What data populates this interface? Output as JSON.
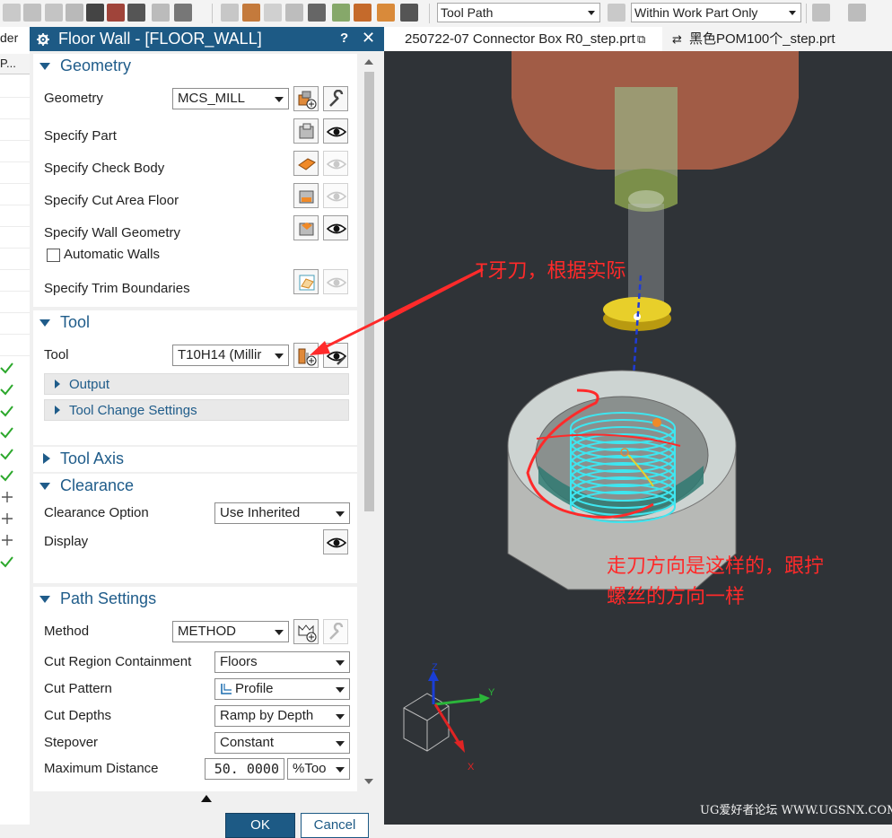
{
  "toolbar": {
    "filter_combo": "Tool Path",
    "scope_combo": "Within Work Part Only"
  },
  "left_strip": {
    "header": "der",
    "col": "P..."
  },
  "dialog": {
    "title": "Floor Wall - [FLOOR_WALL]",
    "help": "?",
    "close": "✕",
    "ok": "OK",
    "cancel": "Cancel"
  },
  "geometry": {
    "heading": "Geometry",
    "geometry_label": "Geometry",
    "geometry_value": "MCS_MILL",
    "specify_part": "Specify Part",
    "specify_check_body": "Specify Check Body",
    "specify_cut_area_floor": "Specify Cut Area Floor",
    "specify_wall_geometry": "Specify Wall Geometry",
    "automatic_walls": "Automatic Walls",
    "specify_trim_boundaries": "Specify Trim Boundaries"
  },
  "tool": {
    "heading": "Tool",
    "tool_label": "Tool",
    "tool_value": "T10H14 (Millir",
    "output": "Output",
    "tool_change_settings": "Tool Change Settings"
  },
  "tool_axis": {
    "heading": "Tool Axis"
  },
  "clearance": {
    "heading": "Clearance",
    "option_label": "Clearance Option",
    "option_value": "Use Inherited",
    "display_label": "Display"
  },
  "path_settings": {
    "heading": "Path Settings",
    "method_label": "Method",
    "method_value": "METHOD",
    "containment_label": "Cut Region Containment",
    "containment_value": "Floors",
    "pattern_label": "Cut Pattern",
    "pattern_value": "Profile",
    "depths_label": "Cut Depths",
    "depths_value": "Ramp by Depth",
    "stepover_label": "Stepover",
    "stepover_value": "Constant",
    "max_distance_label": "Maximum Distance",
    "max_distance_value": "50. 0000",
    "max_distance_unit": "%Too"
  },
  "tabs": [
    {
      "label": "250722-07 Connector Box R0_step.prt"
    },
    {
      "label": "黑色POM100个_step.prt"
    }
  ],
  "viewport": {
    "note_tool": "T牙刀，根据实际",
    "note_dir_line1": "走刀方向是这样的，跟拧",
    "note_dir_line2": "螺丝的方向一样",
    "axis_x": "X",
    "axis_y": "Y",
    "axis_z": "Z",
    "watermark": "UG爱好者论坛 WWW.UGSNX.COM"
  },
  "colors": {
    "title_bar": "#1d5a85",
    "group_heading": "#1f5c8a",
    "annotation": "#ff2a2a",
    "toolpath": "#3ee6f0",
    "viewport_bg": "#2f3337"
  }
}
